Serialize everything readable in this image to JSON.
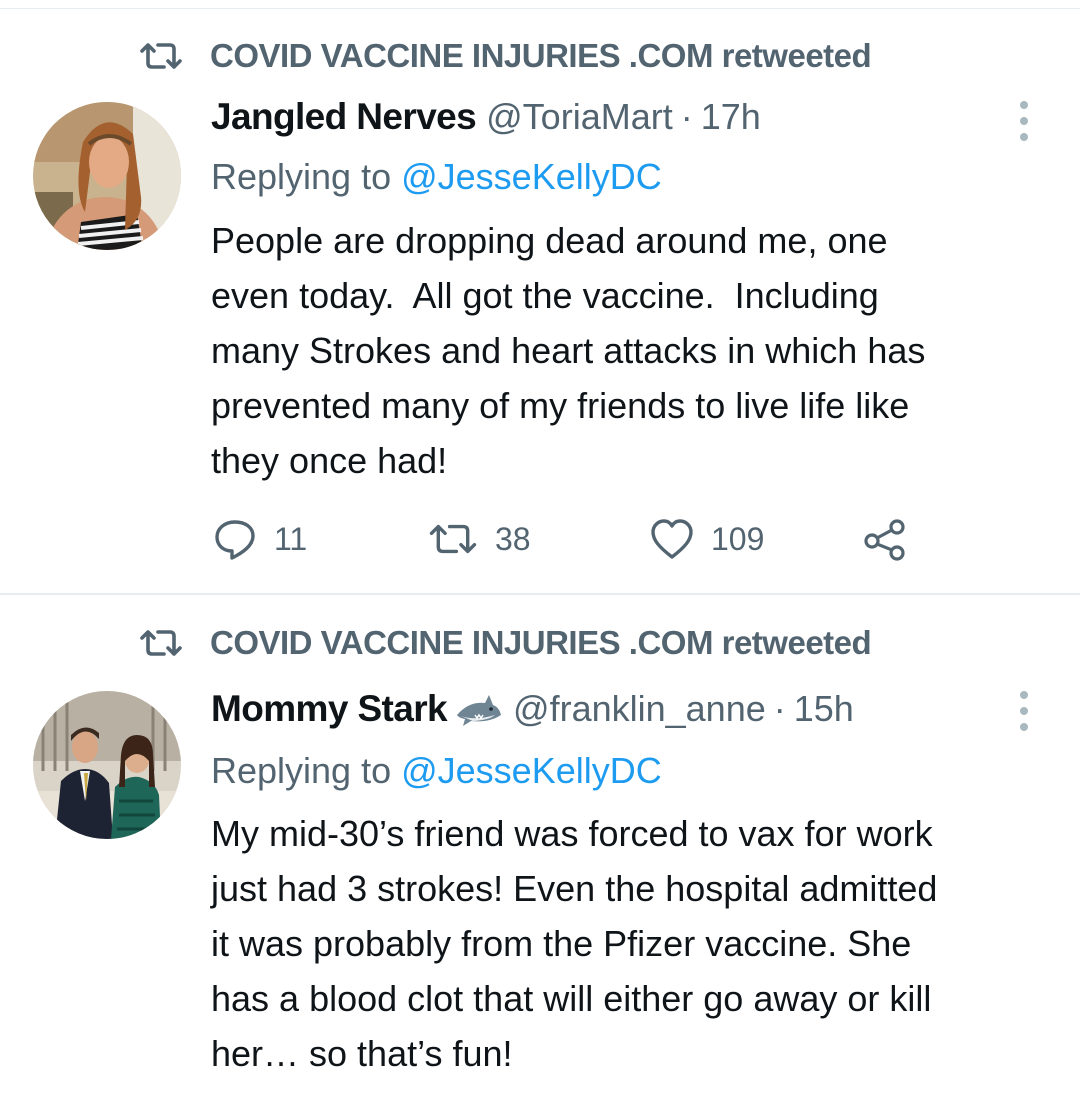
{
  "tweets": [
    {
      "retweeted_by": "COVID VACCINE INJURIES .COM retweeted",
      "author_name": "Jangled Nerves",
      "handle": "@ToriaMart",
      "separator": "·",
      "time": "17h",
      "replying_prefix": "Replying to ",
      "replying_to": "@JesseKellyDC",
      "text": "People are dropping dead around me, one\neven today.  All got the vaccine.  Including\nmany Strokes and heart attacks in which has\nprevented many of my friends to live life like\nthey once had!",
      "counts": {
        "replies": "11",
        "retweets": "38",
        "likes": "109"
      }
    },
    {
      "retweeted_by": "COVID VACCINE INJURIES .COM retweeted",
      "author_name": "Mommy Stark",
      "name_emoji": "shark-icon",
      "handle": "@franklin_anne",
      "separator": "·",
      "time": "15h",
      "replying_prefix": "Replying to ",
      "replying_to": "@JesseKellyDC",
      "text": "My mid-30’s friend was forced to vax for work\njust had 3 strokes! Even the hospital admitted\nit was probably from the Pfizer vaccine. She\nhas a blood clot that will either go away or kill\nher… so that’s fun!"
    }
  ],
  "colors": {
    "text": "#0f1419",
    "secondary": "#536471",
    "link": "#1d9bf0",
    "divider": "#e6ecf0"
  },
  "icons": {
    "retweet": "retweet-icon",
    "reply": "reply-icon",
    "like": "heart-icon",
    "share": "share-icon",
    "more": "more-options-icon"
  }
}
